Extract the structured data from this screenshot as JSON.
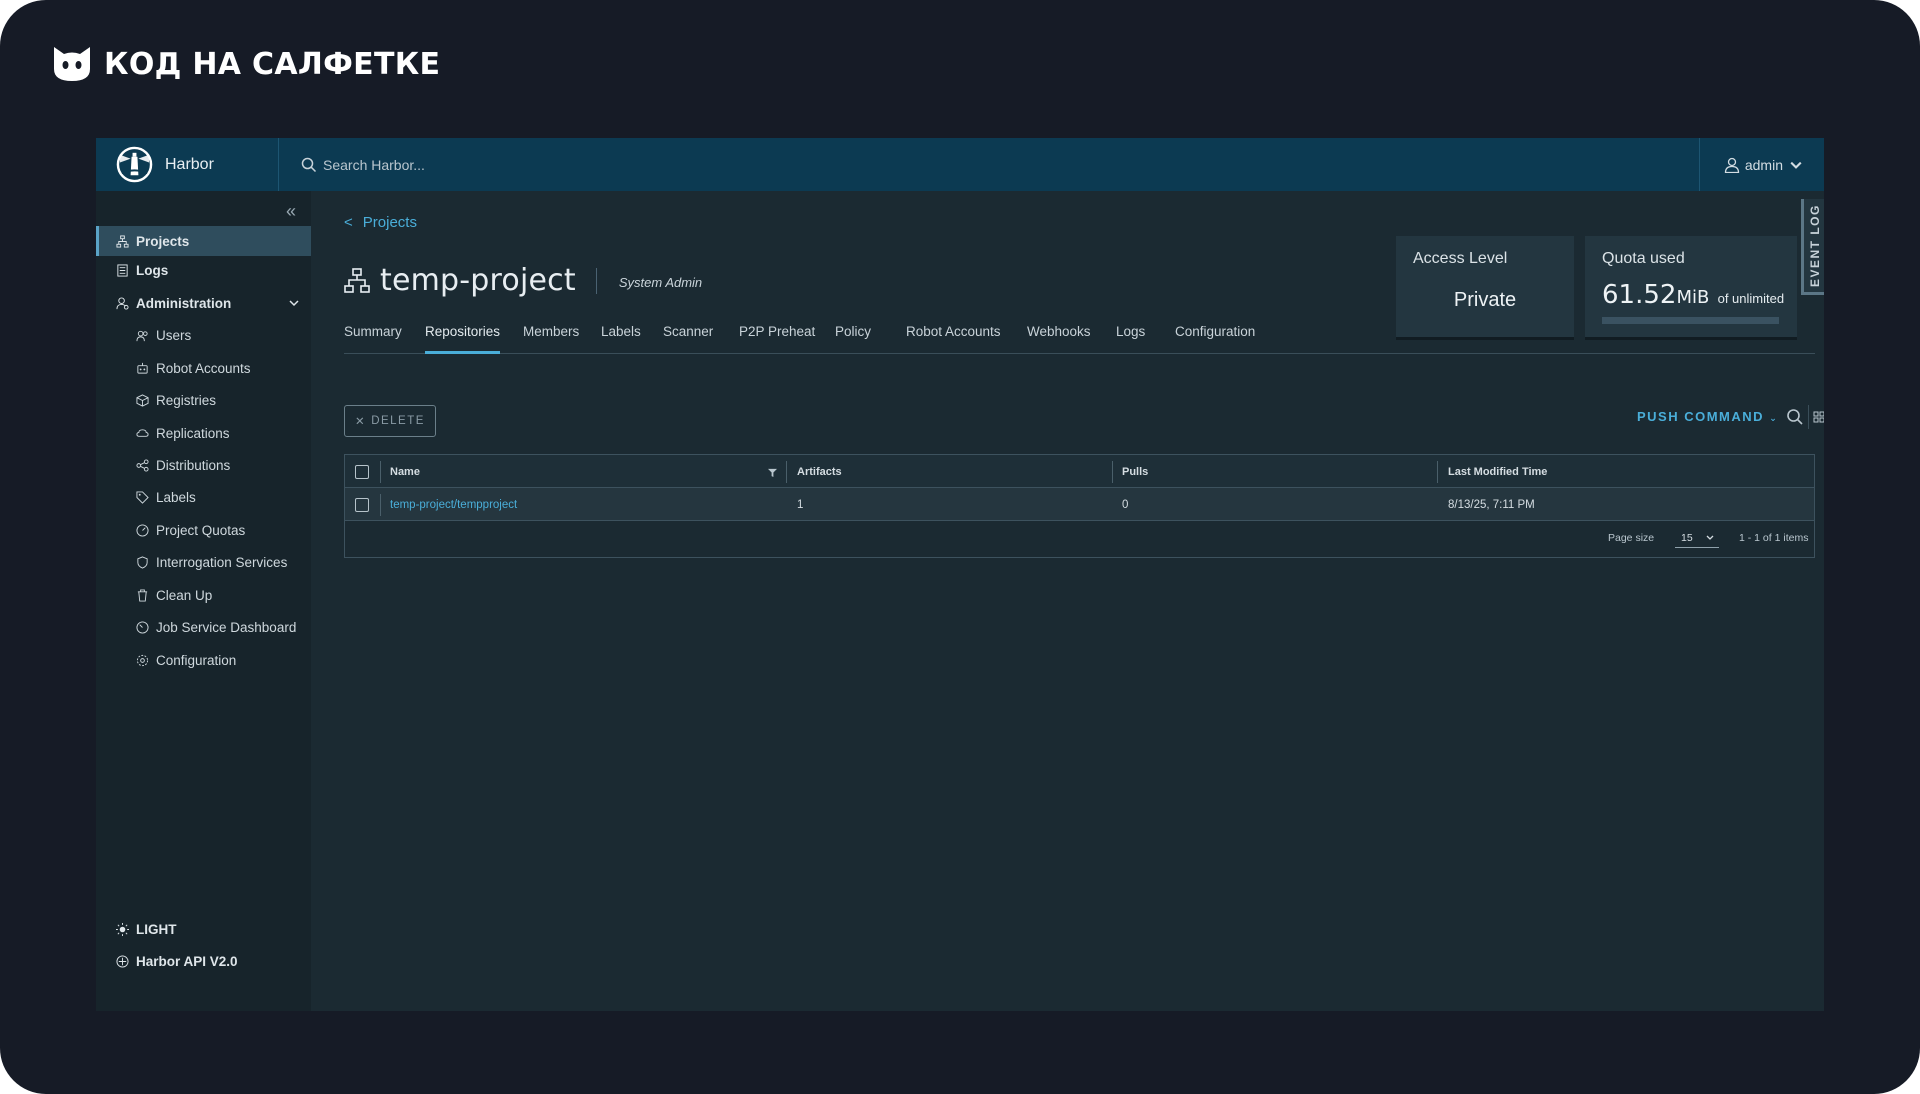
{
  "brand": {
    "text": "КОД НА САЛФЕТКЕ"
  },
  "header": {
    "app_name": "Harbor",
    "search_placeholder": "Search Harbor...",
    "user": "admin"
  },
  "sidebar": {
    "items": [
      {
        "label": "Projects",
        "icon": "projects-icon"
      },
      {
        "label": "Logs",
        "icon": "logs-icon"
      },
      {
        "label": "Administration",
        "icon": "administration-icon"
      },
      {
        "label": "Users",
        "icon": "users-icon"
      },
      {
        "label": "Robot Accounts",
        "icon": "robot-icon"
      },
      {
        "label": "Registries",
        "icon": "registries-icon"
      },
      {
        "label": "Replications",
        "icon": "replications-icon"
      },
      {
        "label": "Distributions",
        "icon": "distributions-icon"
      },
      {
        "label": "Labels",
        "icon": "tag-icon"
      },
      {
        "label": "Project Quotas",
        "icon": "quota-icon"
      },
      {
        "label": "Interrogation Services",
        "icon": "shield-icon"
      },
      {
        "label": "Clean Up",
        "icon": "trash-icon"
      },
      {
        "label": "Job Service Dashboard",
        "icon": "dashboard-icon"
      },
      {
        "label": "Configuration",
        "icon": "gear-icon"
      }
    ],
    "theme_toggle": "LIGHT",
    "api_link": "Harbor API V2.0"
  },
  "main": {
    "breadcrumb": "Projects",
    "project_name": "temp-project",
    "role": "System Admin",
    "access_level": {
      "title": "Access Level",
      "value": "Private"
    },
    "quota": {
      "title": "Quota used",
      "number": "61.52",
      "unit": "MiB",
      "suffix": "of unlimited",
      "fill_fraction": 0
    },
    "event_log": "EVENT LOG",
    "tabs": [
      "Summary",
      "Repositories",
      "Members",
      "Labels",
      "Scanner",
      "P2P Preheat",
      "Policy",
      "Robot Accounts",
      "Webhooks",
      "Logs",
      "Configuration"
    ],
    "active_tab": "Repositories",
    "delete_label": "DELETE",
    "push_command": "PUSH COMMAND",
    "table": {
      "columns": [
        "Name",
        "Artifacts",
        "Pulls",
        "Last Modified Time"
      ],
      "rows": [
        {
          "name": "temp-project/tempproject",
          "artifacts": "1",
          "pulls": "0",
          "modified": "8/13/25, 7:11 PM"
        }
      ],
      "page_size_label": "Page size",
      "page_size": "15",
      "items_summary": "1 - 1 of 1 items"
    }
  }
}
